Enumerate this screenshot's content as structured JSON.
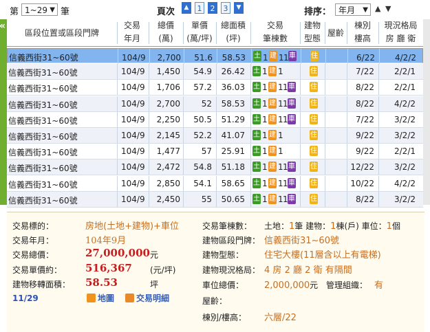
{
  "toolbar": {
    "prefix": "第",
    "range_value": "1~29",
    "suffix": "筆",
    "page_label": "頁次",
    "pages": [
      "1",
      "2",
      "3"
    ],
    "sort_label": "排序：",
    "sort_value": "年月",
    "prev_icon": "triangle-up-icon",
    "next_icon": "triangle-down-icon"
  },
  "table": {
    "headers": [
      [
        "區段位置或區段門牌"
      ],
      [
        "交易",
        "年月"
      ],
      [
        "總價",
        "(萬)"
      ],
      [
        "單價",
        "(萬/坪)"
      ],
      [
        "總面積",
        "(坪)"
      ],
      [
        "交易",
        "筆棟數"
      ],
      [
        "建物",
        "型態"
      ],
      [
        "屋齡"
      ],
      [
        "棟別",
        "樓高"
      ],
      [
        "現況格局",
        "房 廳 衛"
      ]
    ],
    "badge_labels": {
      "land": "土",
      "building": "建",
      "parking": "車",
      "residence": "住"
    },
    "rows": [
      {
        "addr": "信義西街31~60號",
        "ym": "104/9",
        "total": "2,700",
        "unit": "51.6",
        "area": "58.53",
        "n1": "1",
        "n2": "1",
        "n3": "1",
        "car": true,
        "floor": "6/22",
        "layout": "4/2/2"
      },
      {
        "addr": "信義西街31~60號",
        "ym": "104/9",
        "total": "1,450",
        "unit": "54.9",
        "area": "26.42",
        "n1": "1",
        "n2": "1",
        "n3": "",
        "car": false,
        "floor": "7/22",
        "layout": "2/2/1"
      },
      {
        "addr": "信義西街31~60號",
        "ym": "104/9",
        "total": "1,706",
        "unit": "57.2",
        "area": "36.03",
        "n1": "1",
        "n2": "1",
        "n3": "1",
        "car": true,
        "floor": "8/22",
        "layout": "2/2/1"
      },
      {
        "addr": "信義西街31~60號",
        "ym": "104/9",
        "total": "2,700",
        "unit": "52",
        "area": "58.53",
        "n1": "1",
        "n2": "1",
        "n3": "1",
        "car": true,
        "floor": "8/22",
        "layout": "4/2/2"
      },
      {
        "addr": "信義西街31~60號",
        "ym": "104/9",
        "total": "2,250",
        "unit": "50.5",
        "area": "51.29",
        "n1": "1",
        "n2": "1",
        "n3": "1",
        "car": true,
        "floor": "7/22",
        "layout": "3/2/2"
      },
      {
        "addr": "信義西街31~60號",
        "ym": "104/9",
        "total": "2,145",
        "unit": "52.2",
        "area": "41.07",
        "n1": "1",
        "n2": "1",
        "n3": "",
        "car": false,
        "floor": "9/22",
        "layout": "3/2/2"
      },
      {
        "addr": "信義西街31~60號",
        "ym": "104/9",
        "total": "1,477",
        "unit": "57",
        "area": "25.91",
        "n1": "1",
        "n2": "1",
        "n3": "",
        "car": false,
        "floor": "9/22",
        "layout": "2/2/1"
      },
      {
        "addr": "信義西街31~60號",
        "ym": "104/9",
        "total": "2,472",
        "unit": "54.8",
        "area": "51.18",
        "n1": "1",
        "n2": "1",
        "n3": "1",
        "car": true,
        "floor": "12/22",
        "layout": "3/2/2"
      },
      {
        "addr": "信義西街31~60號",
        "ym": "104/9",
        "total": "2,850",
        "unit": "54.1",
        "area": "58.65",
        "n1": "1",
        "n2": "1",
        "n3": "1",
        "car": true,
        "floor": "10/22",
        "layout": "4/2/2"
      },
      {
        "addr": "信義西街31~60號",
        "ym": "104/9",
        "total": "2,450",
        "unit": "55",
        "area": "50.65",
        "n1": "1",
        "n2": "1",
        "n3": "1",
        "car": true,
        "floor": "8/22",
        "layout": "3/2/2"
      }
    ]
  },
  "detail": {
    "target_label": "交易標的：",
    "target_value": "房地(土地+建物)+車位",
    "ym_label": "交易年月：",
    "ym_value": "104年9月",
    "total_label": "交易總價：",
    "total_value": "27,000,000",
    "total_unit": "元",
    "unit_label": "交易單價約：",
    "unit_value": "516,367",
    "unit_unit": "(元/坪)",
    "area_label": "建物移轉面積：",
    "area_value": "58.53",
    "area_unit": "坪",
    "index": "11/29",
    "map_label": "地圖",
    "detail_label": "交易明細",
    "count_label": "交易筆棟數：",
    "count_land_label": "土地：",
    "count_land": "1",
    "count_land_unit": "筆",
    "count_bldg_label": "建物：",
    "count_bldg": "1",
    "count_bldg_unit": "棟(戶)",
    "count_car_label": "車位：",
    "count_car": "1",
    "count_car_unit": "個",
    "addr_label": "建物區段門牌：",
    "addr_value": "信義西街31~60號",
    "type_label": "建物型態：",
    "type_value": "住宅大樓(11層含以上有電梯)",
    "layout_label": "建物現況格局：",
    "layout_rooms": "4",
    "layout_rooms_unit": "房",
    "layout_halls": "2",
    "layout_halls_unit": "廳",
    "layout_baths": "2",
    "layout_baths_unit": "衛",
    "layout_partition": "有隔間",
    "car_price_label": "車位總價：",
    "car_price_value": "2,000,000",
    "car_price_unit": "元",
    "mgmt_label": "管理組織：",
    "mgmt_value": "有",
    "age_label": "屋齡：",
    "floor_label": "棟別/樓高：",
    "floor_value": "六層/22"
  },
  "colors": {
    "selected_row": "#82b4ef",
    "accent_orange": "#c66f22",
    "accent_red": "#c41e1e",
    "strip_green": "#6fae2e"
  }
}
